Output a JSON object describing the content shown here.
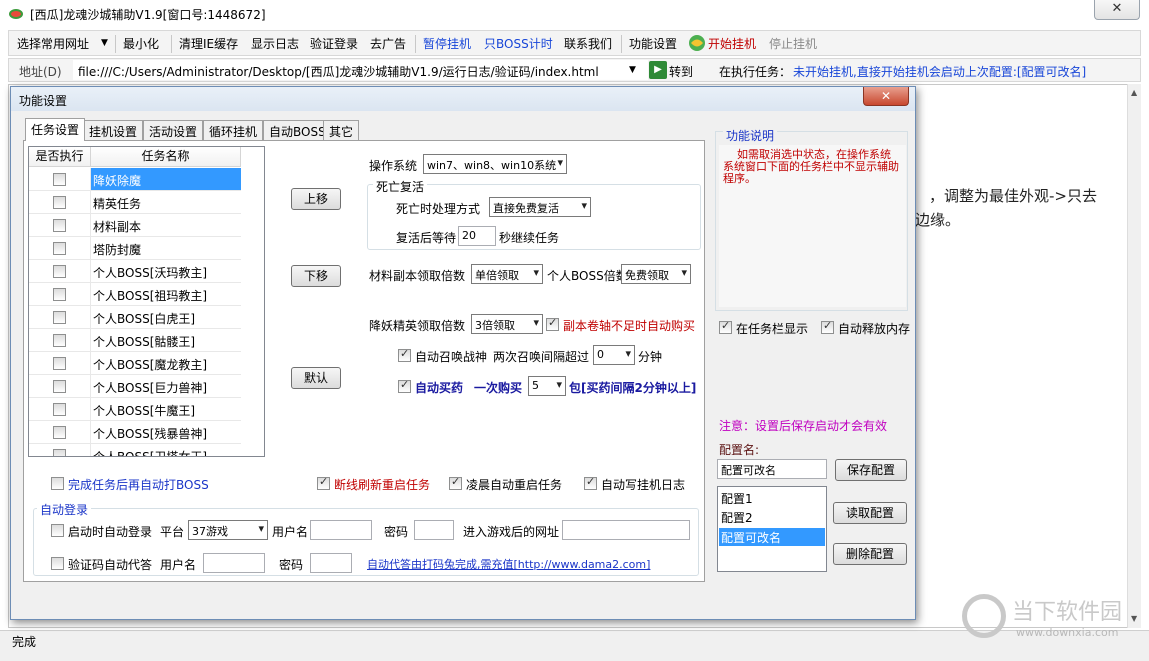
{
  "window": {
    "title": "[西瓜]龙魂沙城辅助V1.9[窗口号:1448672]",
    "close_icon": "✕"
  },
  "menubar": {
    "items": [
      "选择常用网址",
      "最小化",
      "清理IE缓存",
      "显示日志",
      "验证登录",
      "去广告",
      "暂停挂机",
      "只BOSS计时",
      "联系我们",
      "功能设置",
      "开始挂机",
      "停止挂机"
    ]
  },
  "addressbar": {
    "label": "地址(D)",
    "url": "file:///C:/Users/Administrator/Desktop/[西瓜]龙魂沙城辅助V1.9/运行日志/验证码/index.html",
    "go_label": "转到",
    "task_label": "在执行任务：",
    "task_value": "未开始挂机,直接开始挂机会启动上次配置:[配置可改名]"
  },
  "background_text": {
    "line1": "，调整为最佳外观->只去",
    "line2": "边缘。"
  },
  "status": {
    "text": "完成"
  },
  "watermark": {
    "text": "当下软件园",
    "url": "www.downxia.com"
  },
  "dialog": {
    "title": "功能设置",
    "close_icon": "✕",
    "tabs": [
      "任务设置",
      "挂机设置",
      "活动设置",
      "循环挂机",
      "自动BOSS",
      "其它"
    ],
    "list": {
      "col_exec": "是否执行",
      "col_name": "任务名称",
      "rows": [
        "降妖除魔",
        "精英任务",
        "材料副本",
        "塔防封魔",
        "个人BOSS[沃玛教主]",
        "个人BOSS[祖玛教主]",
        "个人BOSS[白虎王]",
        "个人BOSS[骷髅王]",
        "个人BOSS[魔龙教主]",
        "个人BOSS[巨力兽神]",
        "个人BOSS[牛魔王]",
        "个人BOSS[残暴兽神]",
        "个人BOSS[卫塔女王]"
      ]
    },
    "buttons": {
      "up": "上移",
      "down": "下移",
      "default": "默认",
      "save_config": "保存配置",
      "load_config": "读取配置",
      "delete_config": "删除配置"
    },
    "settings": {
      "os_label": "操作系统",
      "os_value": "win7、win8、win10系统",
      "death_group": "死亡复活",
      "death_label": "死亡时处理方式",
      "death_value": "直接免费复活",
      "revive_wait_label": "复活后等待",
      "revive_wait_value": "20",
      "revive_wait_suffix": "秒继续任务",
      "material_label": "材料副本领取倍数",
      "material_value": "单倍领取",
      "personal_boss_label": "个人BOSS倍数",
      "personal_boss_value": "免费领取",
      "elite_label": "降妖精英领取倍数",
      "elite_value": "3倍领取",
      "scroll_buy_label": "副本卷轴不足时自动购买",
      "auto_summon_label": "自动召唤战神",
      "summon_interval_label": "两次召唤间隔超过",
      "summon_interval_value": "0",
      "summon_interval_suffix": "分钟",
      "auto_buy_label": "自动买药",
      "buy_once_label": "一次购买",
      "buy_once_value": "5",
      "buy_once_suffix": "包[买药间隔2分钟以上]",
      "boss_after_task": "完成任务后再自动打BOSS",
      "reconnect_restart": "断线刷新重启任务",
      "dawn_restart": "凌晨自动重启任务",
      "auto_log": "自动写挂机日志"
    },
    "autologin": {
      "group": "自动登录",
      "startup_label": "启动时自动登录",
      "platform_label": "平台",
      "platform_value": "37游戏",
      "username_label": "用户名",
      "password_label": "密码",
      "url_label": "进入游戏后的网址",
      "captcha_label": "验证码自动代答",
      "captcha_user_label": "用户名",
      "captcha_pass_label": "密码",
      "captcha_link": "自动代答由打码兔完成,需充值[http://www.dama2.com]"
    },
    "right": {
      "help_title": "功能说明",
      "help_text": "如需取消选中状态，在操作系统系统窗口下面的任务栏中不显示辅助程序。",
      "taskbar_show": "在任务栏显示",
      "auto_free_mem": "自动释放内存",
      "note": "注意：设置后保存启动才会有效",
      "config_name_label": "配置名:",
      "config_name_value": "配置可改名",
      "configs": [
        "配置1",
        "配置2",
        "配置可改名"
      ]
    }
  }
}
